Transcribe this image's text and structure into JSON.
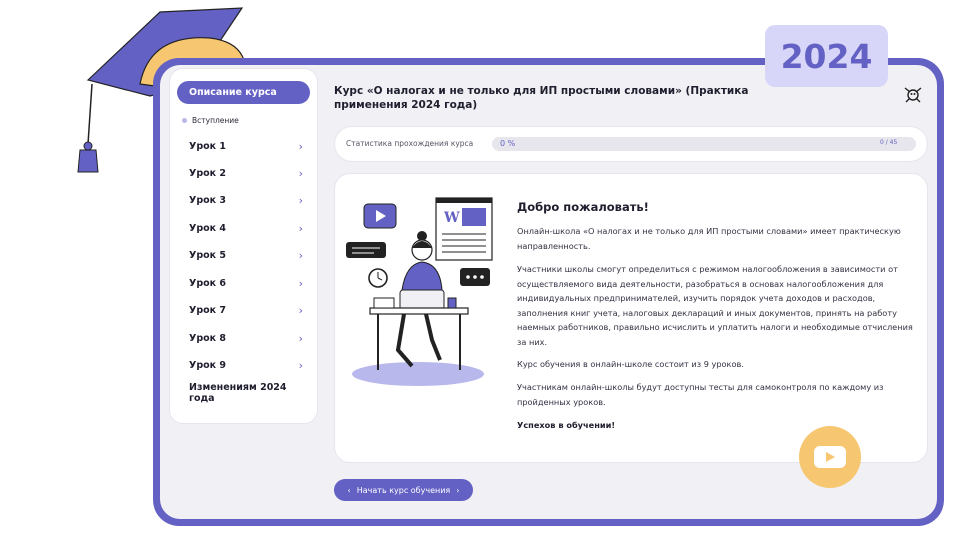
{
  "badge": {
    "year": "2024"
  },
  "sidebar": {
    "active_label": "Описание курса",
    "sub_label": "Вступление",
    "items": [
      {
        "label": "Урок 1"
      },
      {
        "label": "Урок 2"
      },
      {
        "label": "Урок 3"
      },
      {
        "label": "Урок 4"
      },
      {
        "label": "Урок 5"
      },
      {
        "label": "Урок 6"
      },
      {
        "label": "Урок 7"
      },
      {
        "label": "Урок 8"
      },
      {
        "label": "Урок 9"
      }
    ],
    "last_label": "Изменениям 2024 года"
  },
  "header": {
    "title": "Курс «О налогах и не только для ИП простыми словами» (Практика применения 2024 года)"
  },
  "stats": {
    "label": "Статистика прохождения курса",
    "percent_text": "0 %",
    "progress": 0,
    "count_text": "0 / 45"
  },
  "content": {
    "heading": "Добро пожаловать!",
    "paragraphs": [
      "Онлайн-школа «О налогах и не только для ИП простыми словами» имеет практическую направленность.",
      "Участники школы смогут определиться с режимом налогообложения в зависимости от осуществляемого вида деятельности, разобраться в основах налогообложения для индивидуальных предпринимателей, изучить порядок учета доходов и расходов, заполнения книг учета, налоговых деклараций и иных документов, принять на работу наемных работников, правильно исчислить и уплатить налоги и необходимые отчисления за них.",
      "Курс обучения в онлайн-школе состоит из 9 уроков.",
      "Участникам онлайн-школы будут доступны тесты для самоконтроля по каждому из пройденных уроков.",
      "Успехов в обучении!"
    ]
  },
  "actions": {
    "start_label": "Начать курс обучения",
    "prev_glyph": "‹",
    "next_glyph": "›"
  },
  "icons": {
    "chevron": "chevron-right-icon",
    "video": "play-icon",
    "cap": "graduation-cap-icon"
  },
  "colors": {
    "accent": "#6461c4",
    "accent_light": "#d7d6f8",
    "yellow": "#f6c770",
    "panel": "#f1f1f5"
  }
}
